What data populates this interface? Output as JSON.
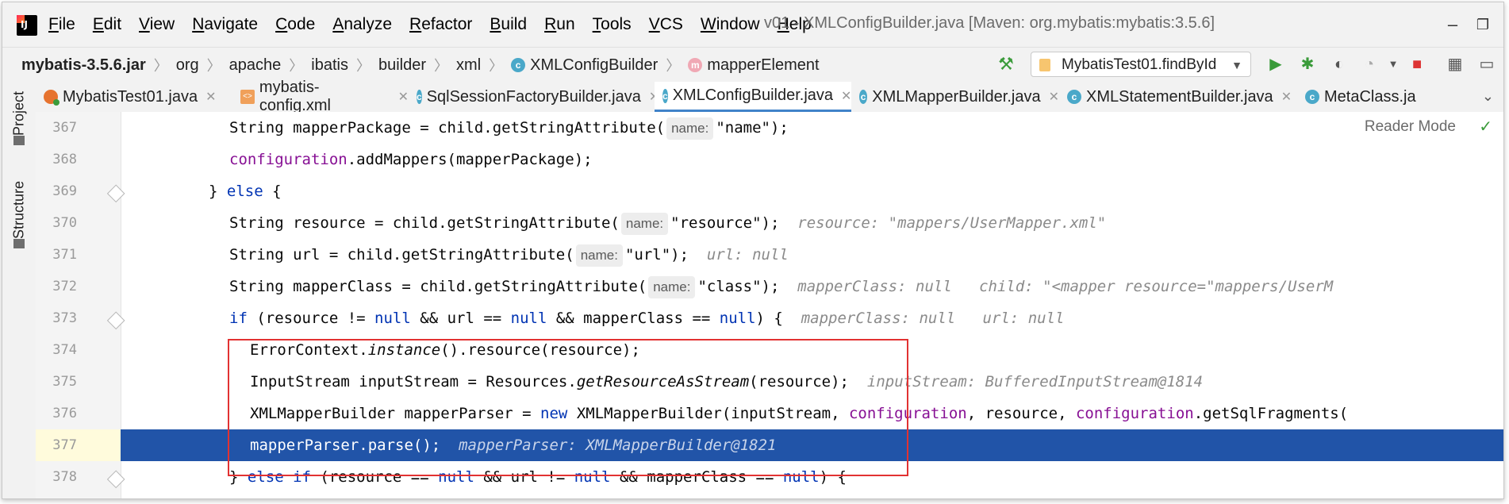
{
  "window": {
    "title": "v01 - XMLConfigBuilder.java [Maven: org.mybatis:mybatis:3.5.6]",
    "menu": [
      "File",
      "Edit",
      "View",
      "Navigate",
      "Code",
      "Analyze",
      "Refactor",
      "Build",
      "Run",
      "Tools",
      "VCS",
      "Window",
      "Help"
    ]
  },
  "breadcrumb": [
    "mybatis-3.5.6.jar",
    "org",
    "apache",
    "ibatis",
    "builder",
    "xml",
    "XMLConfigBuilder",
    "mapperElement"
  ],
  "run_config": "MybatisTest01.findById",
  "tabs": [
    {
      "label": "MybatisTest01.java"
    },
    {
      "label": "mybatis-config.xml"
    },
    {
      "label": "SqlSessionFactoryBuilder.java"
    },
    {
      "label": "XMLConfigBuilder.java"
    },
    {
      "label": "XMLMapperBuilder.java"
    },
    {
      "label": "XMLStatementBuilder.java"
    },
    {
      "label": "MetaClass.ja"
    }
  ],
  "tool_windows": {
    "project": "Project",
    "structure": "Structure"
  },
  "editor": {
    "reader_mode": "Reader Mode",
    "lines": [
      {
        "num": "367"
      },
      {
        "num": "368"
      },
      {
        "num": "369"
      },
      {
        "num": "370"
      },
      {
        "num": "371"
      },
      {
        "num": "372"
      },
      {
        "num": "373"
      },
      {
        "num": "374"
      },
      {
        "num": "375"
      },
      {
        "num": "376"
      },
      {
        "num": "377"
      },
      {
        "num": "378"
      }
    ],
    "hints": {
      "name": "name:"
    },
    "strings": {
      "s367": "\"name\"",
      "s370": "\"resource\"",
      "s371": "\"url\"",
      "s372": "\"class\""
    },
    "debug": {
      "d370": "resource: \"mappers/UserMapper.xml\"",
      "d371": "url: null",
      "d372a": "mapperClass: null",
      "d372b": "child: \"<mapper resource=\"mappers/UserM",
      "d373a": "mapperClass: null",
      "d373b": "url: null",
      "d375": "inputStream: BufferedInputStream@1814",
      "d377": "mapperParser: XMLMapperBuilder@1821"
    }
  }
}
